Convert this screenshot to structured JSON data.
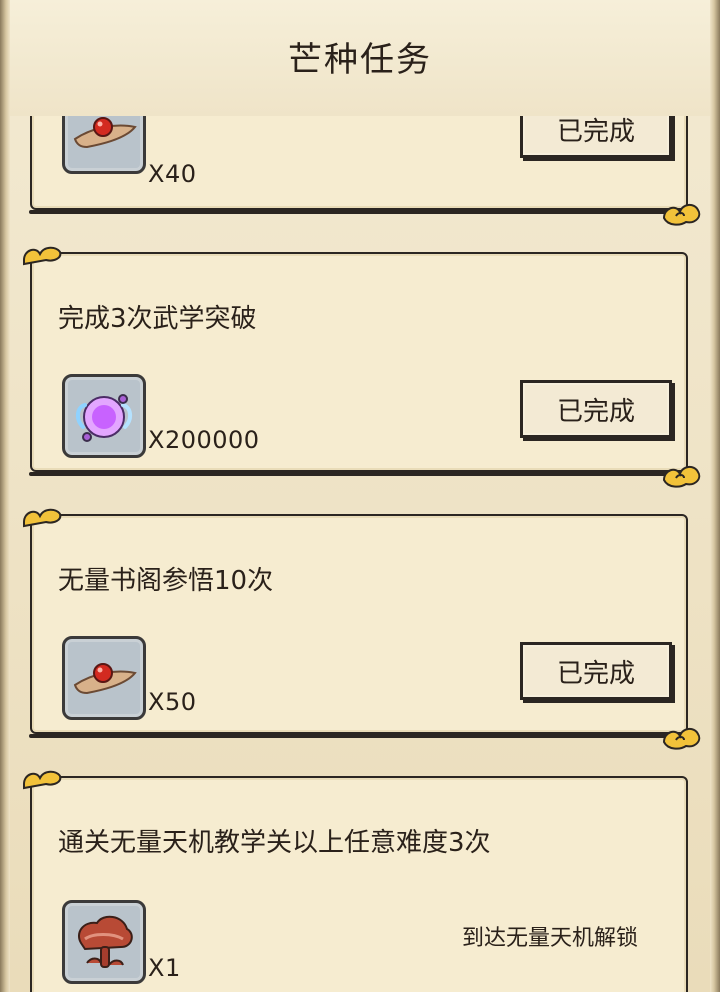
{
  "header": {
    "title": "芒种任务"
  },
  "colors": {
    "background": "#efe4c8",
    "card": "#f6ecd0",
    "ink": "#2a211a",
    "gold": "#f2c23a"
  },
  "tasks": [
    {
      "title": "",
      "reward": {
        "icon": "red-pill-on-cloth-icon",
        "quantity": "X40"
      },
      "status": {
        "label": "已完成"
      }
    },
    {
      "title": "完成3次武学突破",
      "reward": {
        "icon": "purple-orb-icon",
        "quantity": "X200000"
      },
      "status": {
        "label": "已完成"
      }
    },
    {
      "title": "无量书阁参悟10次",
      "reward": {
        "icon": "red-pill-on-cloth-icon",
        "quantity": "X50"
      },
      "status": {
        "label": "已完成"
      }
    },
    {
      "title": "通关无量天机教学关以上任意难度3次",
      "reward": {
        "icon": "mushroom-icon",
        "quantity": "X1"
      },
      "status": {
        "label": "到达无量天机解锁"
      }
    }
  ]
}
